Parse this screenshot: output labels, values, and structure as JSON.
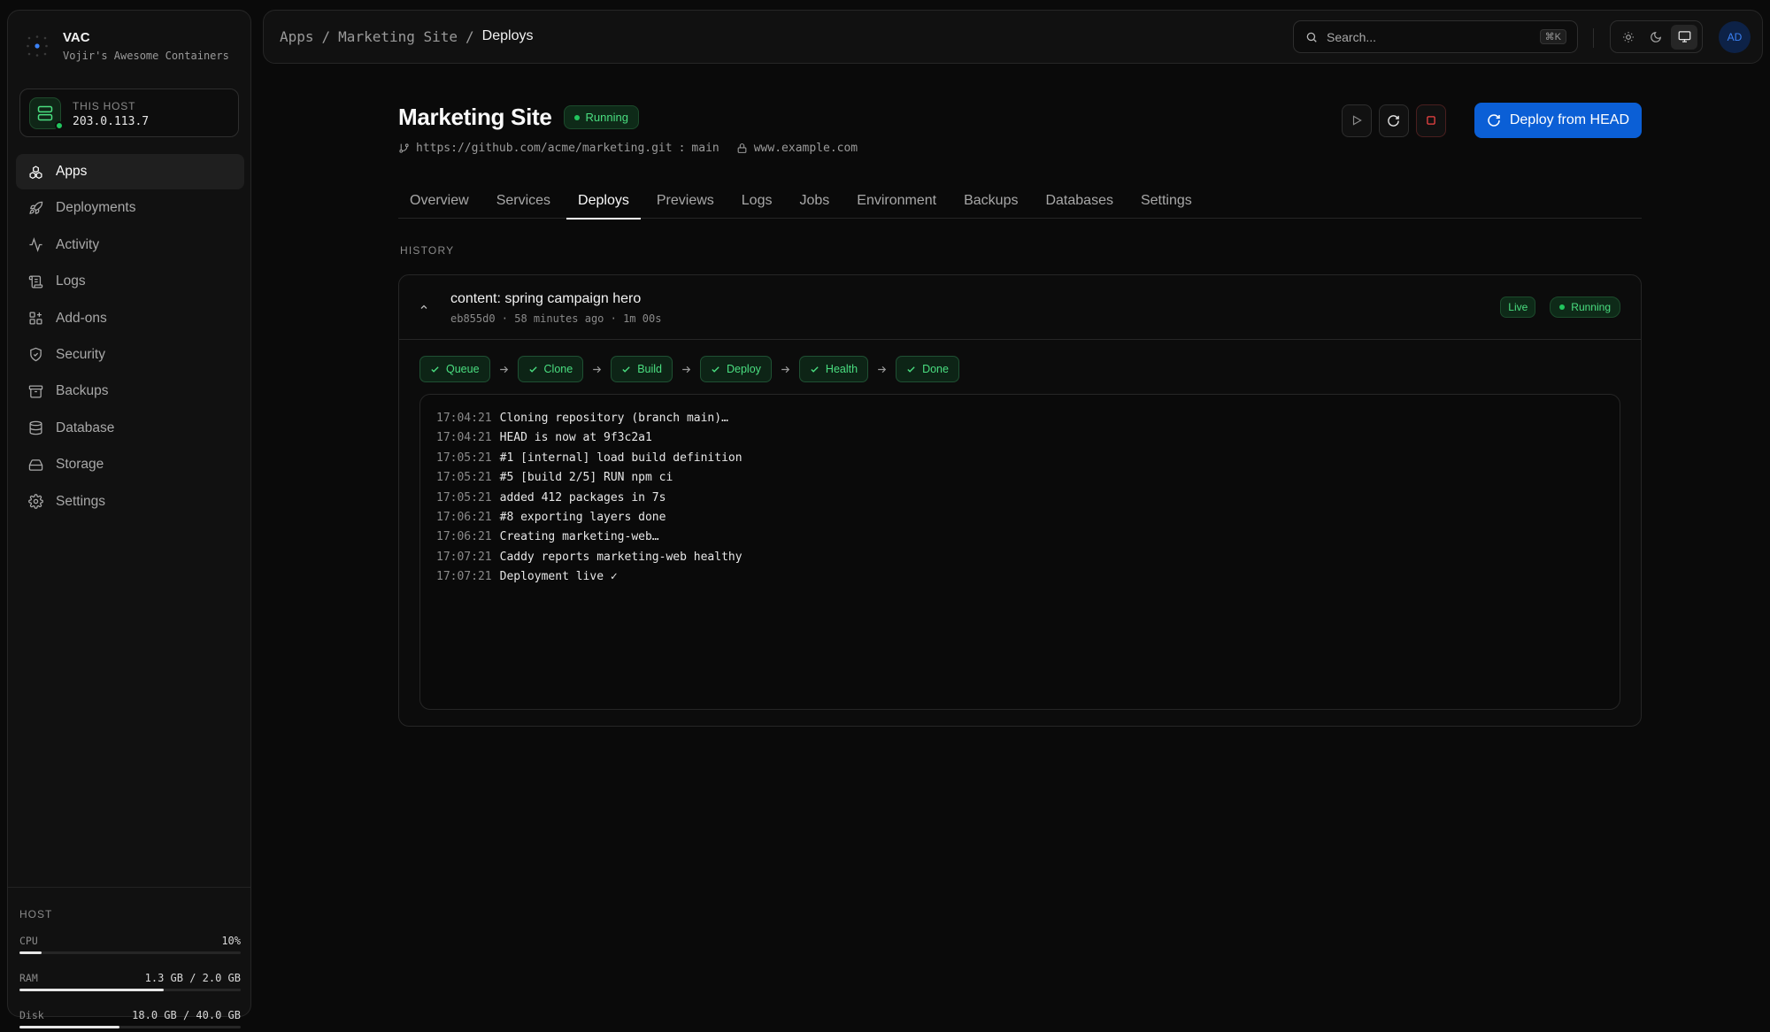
{
  "brand": {
    "name": "VAC",
    "subtitle": "Vojir's Awesome Containers"
  },
  "host_card": {
    "label": "THIS HOST",
    "ip": "203.0.113.7"
  },
  "nav": [
    {
      "label": "Apps",
      "icon": "apps-icon",
      "active": true
    },
    {
      "label": "Deployments",
      "icon": "rocket-icon"
    },
    {
      "label": "Activity",
      "icon": "activity-icon"
    },
    {
      "label": "Logs",
      "icon": "logs-icon"
    },
    {
      "label": "Add-ons",
      "icon": "addons-icon"
    },
    {
      "label": "Security",
      "icon": "shield-icon"
    },
    {
      "label": "Backups",
      "icon": "archive-icon"
    },
    {
      "label": "Database",
      "icon": "database-icon"
    },
    {
      "label": "Storage",
      "icon": "storage-icon"
    },
    {
      "label": "Settings",
      "icon": "gear-icon"
    }
  ],
  "host_metrics": {
    "heading": "HOST",
    "cpu": {
      "label": "CPU",
      "value": "10%",
      "fraction": 0.1
    },
    "ram": {
      "label": "RAM",
      "value": "1.3 GB / 2.0 GB",
      "fraction": 0.65
    },
    "disk": {
      "label": "Disk",
      "value": "18.0 GB / 40.0 GB",
      "fraction": 0.45
    }
  },
  "breadcrumb": {
    "items": [
      "Apps",
      "Marketing Site"
    ],
    "current": "Deploys",
    "separator": "/"
  },
  "search": {
    "placeholder": "Search...",
    "shortcut": "⌘K"
  },
  "user": {
    "initials": "AD"
  },
  "app": {
    "title": "Marketing Site",
    "status": "Running",
    "repo": "https://github.com/acme/marketing.git",
    "branch_sep": ":",
    "branch": "main",
    "domain": "www.example.com",
    "deploy_label": "Deploy from HEAD"
  },
  "tabs": [
    "Overview",
    "Services",
    "Deploys",
    "Previews",
    "Logs",
    "Jobs",
    "Environment",
    "Backups",
    "Databases",
    "Settings"
  ],
  "active_tab": "Deploys",
  "history": {
    "heading": "HISTORY",
    "deploy": {
      "message": "content: spring campaign hero",
      "meta": "eb855d0 · 58 minutes ago · 1m 00s",
      "live_badge": "Live",
      "status": "Running",
      "steps": [
        "Queue",
        "Clone",
        "Build",
        "Deploy",
        "Health",
        "Done"
      ],
      "log": [
        {
          "ts": "17:04:21",
          "msg": "Cloning repository (branch main)…"
        },
        {
          "ts": "17:04:21",
          "msg": "HEAD is now at 9f3c2a1"
        },
        {
          "ts": "17:05:21",
          "msg": "#1 [internal] load build definition"
        },
        {
          "ts": "17:05:21",
          "msg": "#5 [build 2/5] RUN npm ci"
        },
        {
          "ts": "17:05:21",
          "msg": "added 412 packages in 7s"
        },
        {
          "ts": "17:06:21",
          "msg": "#8 exporting layers done"
        },
        {
          "ts": "17:06:21",
          "msg": "Creating marketing-web…"
        },
        {
          "ts": "17:07:21",
          "msg": "Caddy reports marketing-web healthy"
        },
        {
          "ts": "17:07:21",
          "msg": "Deployment live ✓"
        }
      ]
    }
  },
  "colors": {
    "accent": "#0b5fd6",
    "success": "#22c55e",
    "success_text": "#4ade80",
    "background": "#0a0a0a"
  }
}
